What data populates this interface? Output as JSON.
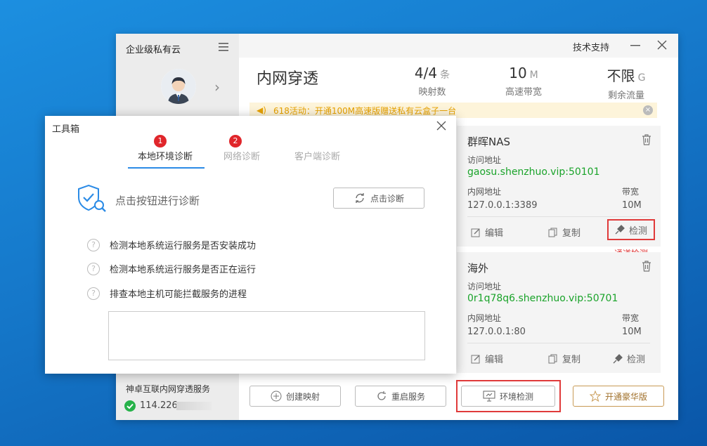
{
  "colors": {
    "accent_blue": "#2b8be6",
    "success_green": "#1aa32a",
    "danger_red": "#e03a3a",
    "promo_orange": "#e6a100",
    "gold": "#c89a55"
  },
  "sidebar": {
    "brand": "企业级私有云",
    "service_title": "神卓互联内网穿透服务",
    "service_ip": "114.226"
  },
  "titlebar": {
    "support": "技术支持"
  },
  "main": {
    "title": "内网穿透",
    "stats": [
      {
        "value": "4/4",
        "unit": "条",
        "label": "映射数"
      },
      {
        "value": "10",
        "unit": "M",
        "label": "高速带宽"
      },
      {
        "value": "不限",
        "unit": "G",
        "label": "剩余流量"
      }
    ],
    "promo": "618活动：开通100M高速版赠送私有云盒子一台"
  },
  "cards": [
    {
      "name": "群晖NAS",
      "access_label": "访问地址",
      "access_value": "gaosu.shenzhuo.vip:50101",
      "lan_label": "内网地址",
      "lan_value": "127.0.0.1:3389",
      "bw_label": "带宽",
      "bw_value": "10M",
      "edit": "编辑",
      "copy": "复制",
      "check": "检测"
    },
    {
      "name": "海外",
      "access_label": "访问地址",
      "access_value": "0r1q78q6.shenzhuo.vip:50701",
      "lan_label": "内网地址",
      "lan_value": "127.0.0.1:80",
      "bw_label": "带宽",
      "bw_value": "10M",
      "edit": "编辑",
      "copy": "复制",
      "check": "检测"
    }
  ],
  "channel_check_label": "通道检测",
  "bottom_buttons": {
    "create": "创建映射",
    "restart": "重启服务",
    "env_check": "环境检测",
    "upgrade": "开通豪华版"
  },
  "toolbox": {
    "title": "工具箱",
    "tabs": [
      {
        "label": "本地环境诊断",
        "badge": "1"
      },
      {
        "label": "网络诊断",
        "badge": "2"
      },
      {
        "label": "客户端诊断",
        "badge": ""
      }
    ],
    "prompt": "点击按钮进行诊断",
    "diag_button": "点击诊断",
    "checks": [
      "检测本地系统运行服务是否安装成功",
      "检测本地系统运行服务是否正在运行",
      "排查本地主机可能拦截服务的进程"
    ]
  }
}
